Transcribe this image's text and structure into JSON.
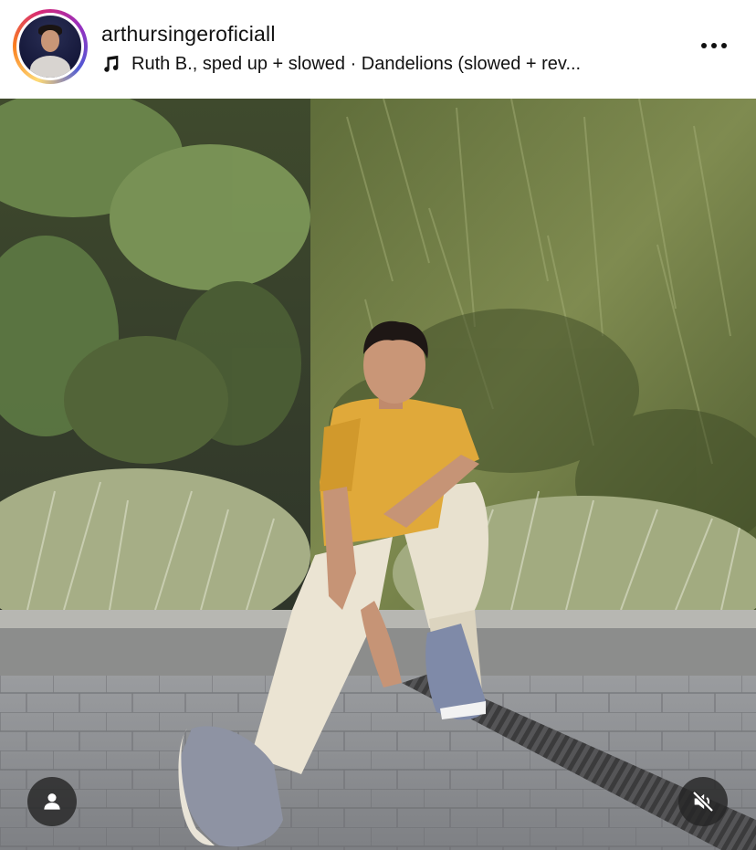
{
  "post": {
    "username": "arthursingeroficiall",
    "audio": {
      "icon": "music-note-icon",
      "text": "Ruth B., sped up + slowed · Dandelions (slowed + rev..."
    },
    "more_icon": "more-options-icon"
  },
  "media": {
    "type": "photo",
    "overlay_buttons": {
      "tagged_user_icon": "person-icon",
      "audio_state_icon": "muted-speaker-icon"
    }
  },
  "colors": {
    "shirt": "#e0a93a",
    "pants": "#e8e1cf",
    "foliage_dark": "#4a5a2c",
    "foliage_light": "#9aa56a",
    "pavement": "#8d8f93",
    "overlay_button": "#262626"
  }
}
